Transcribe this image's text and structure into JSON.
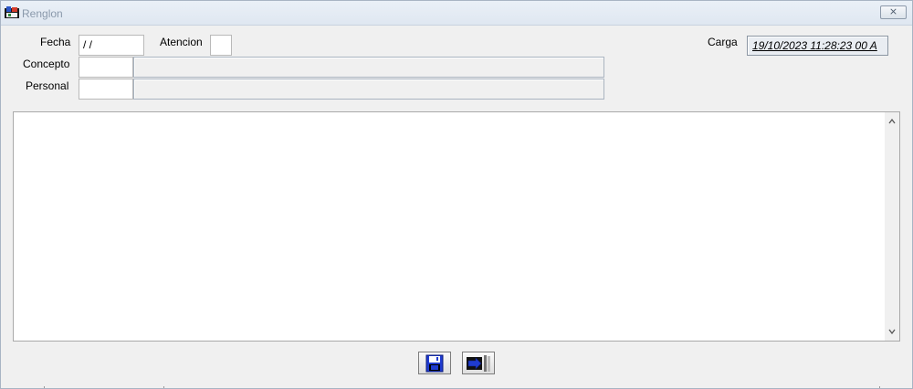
{
  "window": {
    "title": "Renglon",
    "close_symbol": "⨯"
  },
  "form": {
    "fecha": {
      "label": "Fecha",
      "value": " / /"
    },
    "atencion": {
      "label": "Atencion",
      "value": ""
    },
    "carga": {
      "label": "Carga",
      "value": "19/10/2023 11:28:23 00 A"
    },
    "concepto": {
      "label": "Concepto",
      "code": "",
      "description": ""
    },
    "personal": {
      "label": "Personal",
      "code": "",
      "description": ""
    }
  },
  "memo": {
    "text": ""
  },
  "toolbar": {
    "save_icon": "floppy-disk-icon",
    "exit_icon": "exit-door-icon"
  },
  "colors": {
    "title_text": "#8a99ab",
    "icon_blue": "#1f3bd0",
    "window_bg": "#f0f0f0"
  }
}
